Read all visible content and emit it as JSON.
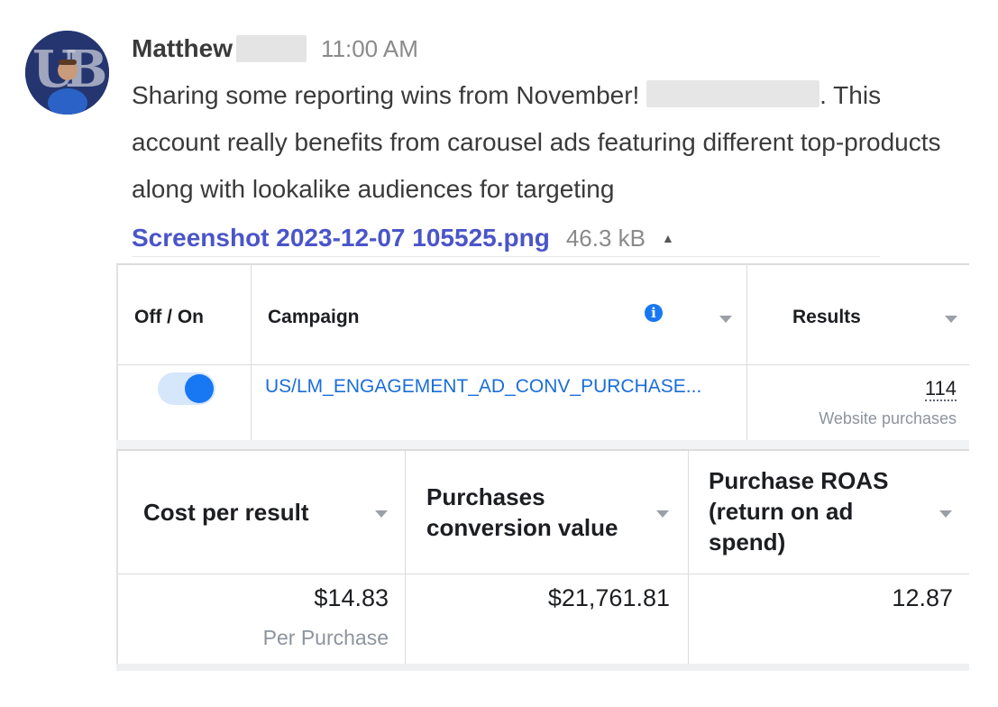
{
  "message": {
    "sender": "Matthew",
    "timestamp": "11:00 AM",
    "text_before": "Sharing some reporting wins from November! ",
    "text_after": ". This account really benefits from carousel ads featuring different top-products along with lookalike audiences for targeting",
    "attachment": {
      "filename": "Screenshot 2023-12-07 105525.png",
      "size": "46.3 kB",
      "collapse_icon": "caret-up-icon"
    }
  },
  "ads_table": {
    "top_headers": {
      "toggle": "Off / On",
      "campaign": "Campaign",
      "results": "Results"
    },
    "row": {
      "toggle_state": "on",
      "campaign": "US/LM_ENGAGEMENT_AD_CONV_PURCHASE...",
      "results_value": "114",
      "results_label": "Website purchases"
    },
    "bottom_headers": {
      "cost": "Cost per result",
      "conv_line1": "Purchases",
      "conv_line2": "conversion value",
      "roas_line1": "Purchase ROAS",
      "roas_line2": "(return on ad",
      "roas_line3": "spend)"
    },
    "values": {
      "cost": "$14.83",
      "cost_label": "Per Purchase",
      "conversion_value": "$21,761.81",
      "roas": "12.87"
    }
  },
  "colors": {
    "link": "#4a55c9",
    "toggle": "#1877f2",
    "campaign_link": "#1a6ed8"
  }
}
